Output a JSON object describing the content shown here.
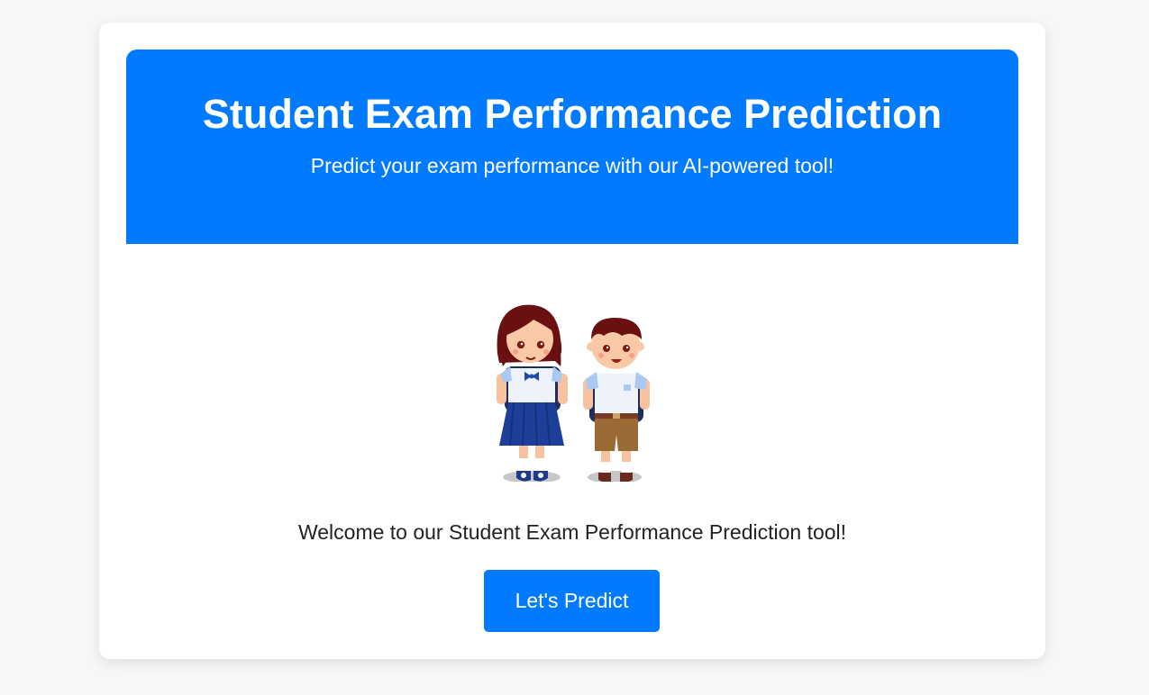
{
  "hero": {
    "title": "Student Exam Performance Prediction",
    "subtitle": "Predict your exam performance with our AI-powered tool!"
  },
  "illustration": {
    "icon": "students-illustration"
  },
  "main": {
    "welcome_text": "Welcome to our Student Exam Performance Prediction tool!",
    "predict_button_label": "Let's Predict"
  },
  "colors": {
    "accent": "#007bff",
    "background": "#f6f7f9",
    "card": "#ffffff",
    "text": "#222222"
  }
}
